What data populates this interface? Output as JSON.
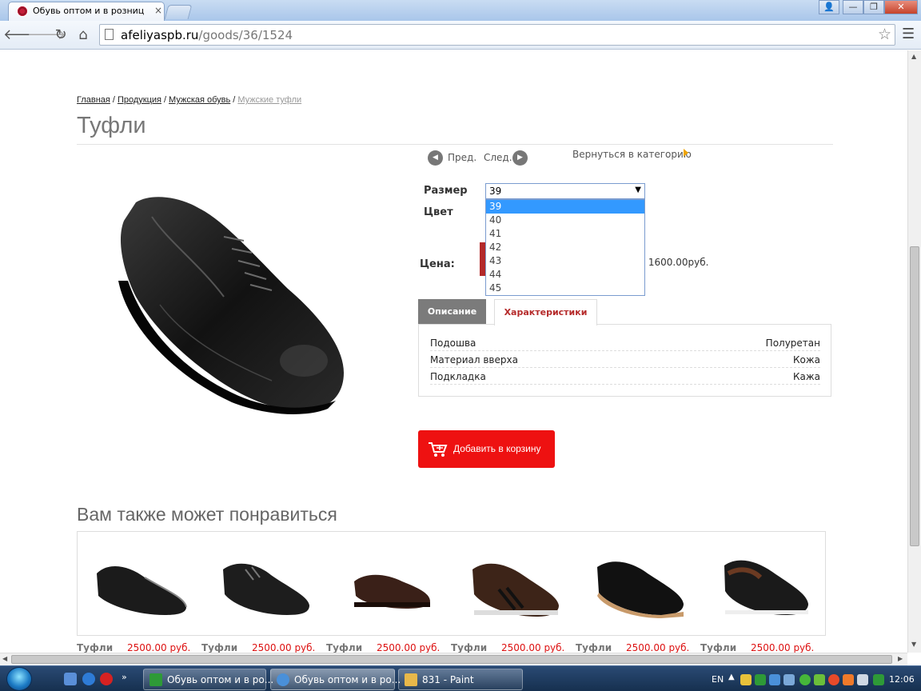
{
  "browser": {
    "tab_title": "Обувь оптом и в розниц",
    "tab_close": "×",
    "url_host": "afeliyaspb.ru",
    "url_path": "/goods/36/1524",
    "window_buttons": [
      "👤",
      "—",
      "❐",
      "✕"
    ]
  },
  "breadcrumb": {
    "items": [
      "Главная",
      "Продукция",
      "Мужская обувь"
    ],
    "current": "Мужские туфли",
    "separator": "/"
  },
  "page_title": "Туфли",
  "product_nav": {
    "prev": "Пред.",
    "next": "След.",
    "back": "Вернуться в категорию"
  },
  "options": {
    "size_label": "Размер",
    "color_label": "Цвет",
    "selected_size": "39",
    "sizes": [
      "39",
      "40",
      "41",
      "42",
      "43",
      "44",
      "45"
    ]
  },
  "price": {
    "label": "Цена:",
    "note": ": 1600.00руб."
  },
  "tabs": {
    "description": "Описание",
    "characteristics": "Характеристики"
  },
  "characteristics": [
    {
      "key": "Подошва",
      "value": "Полуретан"
    },
    {
      "key": "Материал вверха",
      "value": "Кожа"
    },
    {
      "key": "Подкладка",
      "value": "Кажа"
    }
  ],
  "cart": {
    "label": "Добавить в корзину"
  },
  "recommendations": {
    "title": "Вам также может понравиться",
    "items": [
      {
        "name": "Туфли",
        "price": "2500.00 руб.",
        "accent": "#1b1b1b"
      },
      {
        "name": "Туфли",
        "price": "2500.00 руб.",
        "accent": "#1d1d1d"
      },
      {
        "name": "Туфли",
        "price": "2500.00 руб.",
        "accent": "#3a2018"
      },
      {
        "name": "Туфли",
        "price": "2500.00 руб.",
        "accent": "#3d2418"
      },
      {
        "name": "Туфли",
        "price": "2500.00 руб.",
        "accent": "#111111"
      },
      {
        "name": "Туфли",
        "price": "2500.00 руб.",
        "accent": "#1a1a1a"
      }
    ]
  },
  "taskbar": {
    "tasks": [
      {
        "label": "Обувь оптом и в ро...",
        "icon": "#2e9a37"
      },
      {
        "label": "Обувь оптом и в ро...",
        "icon": "#4a90d9"
      },
      {
        "label": "831 - Paint",
        "icon": "#e8b84a"
      }
    ],
    "lang": "EN",
    "clock": "12:06"
  },
  "colors": {
    "accent_red": "#ee1111",
    "tab_active_text": "#b52a2a",
    "selection_blue": "#3399ff"
  }
}
